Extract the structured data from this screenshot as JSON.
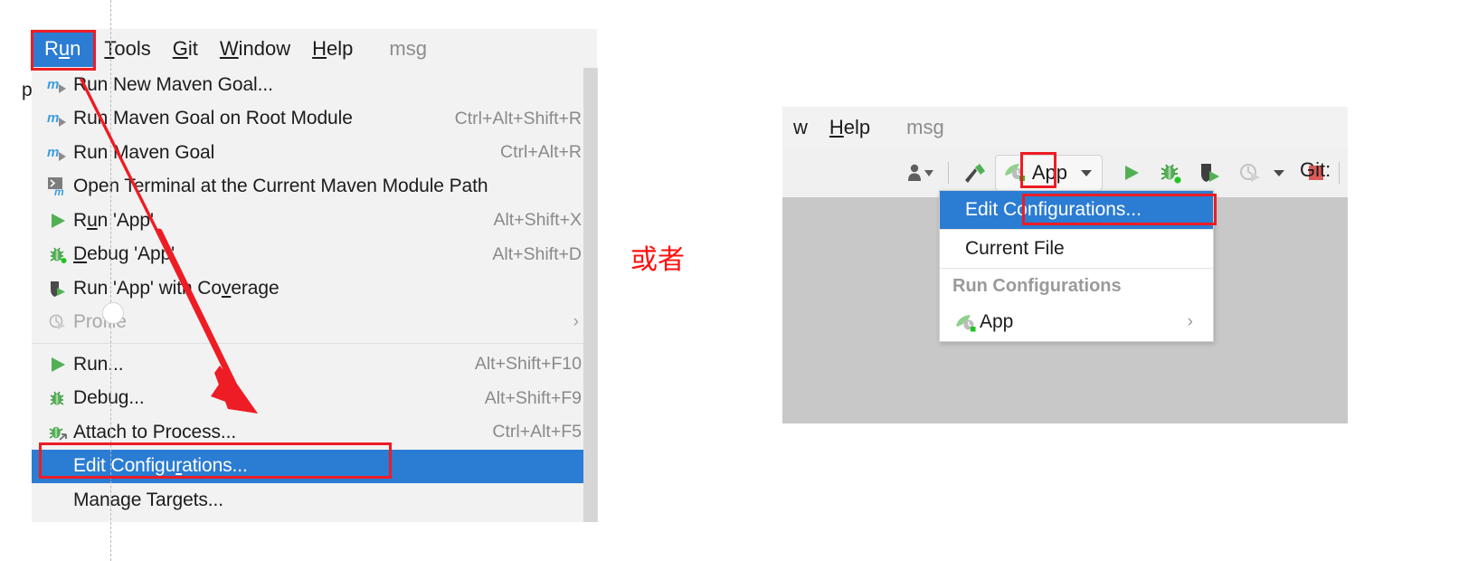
{
  "left_window": {
    "menubar": {
      "items": [
        {
          "label": "Run",
          "accel": "u",
          "selected": true
        },
        {
          "label": "Tools",
          "accel": "T",
          "selected": false
        },
        {
          "label": "Git",
          "accel": "G",
          "selected": false
        },
        {
          "label": "Window",
          "accel": "W",
          "selected": false
        },
        {
          "label": "Help",
          "accel": "H",
          "selected": false
        }
      ],
      "extra_label": "msg"
    },
    "menu_items": [
      {
        "label": "Run New Maven Goal...",
        "shortcut": "",
        "icon": "maven-run-icon",
        "state": "normal"
      },
      {
        "label": "Run Maven Goal on Root Module",
        "shortcut": "Ctrl+Alt+Shift+R",
        "icon": "maven-run-icon",
        "state": "normal"
      },
      {
        "label": "Run Maven Goal",
        "shortcut": "Ctrl+Alt+R",
        "icon": "maven-run-icon",
        "state": "normal"
      },
      {
        "label": "Open Terminal at the Current Maven Module Path",
        "shortcut": "",
        "icon": "maven-terminal-icon",
        "state": "normal"
      },
      {
        "label": "Run 'App'",
        "shortcut": "Alt+Shift+X",
        "icon": "run-play-icon",
        "state": "normal"
      },
      {
        "label": "Debug 'App'",
        "shortcut": "Alt+Shift+D",
        "icon": "debug-bug-icon",
        "state": "normal"
      },
      {
        "label": "Run 'App' with Coverage",
        "shortcut": "",
        "icon": "coverage-shield-icon",
        "state": "normal"
      },
      {
        "label": "Profile",
        "shortcut": "",
        "icon": "profile-icon",
        "state": "disabled",
        "submenu": true
      },
      {
        "separator": true
      },
      {
        "label": "Run...",
        "shortcut": "Alt+Shift+F10",
        "icon": "run-play-icon",
        "state": "normal"
      },
      {
        "label": "Debug...",
        "shortcut": "Alt+Shift+F9",
        "icon": "debug-bug-icon",
        "state": "normal"
      },
      {
        "label": "Attach to Process...",
        "shortcut": "Ctrl+Alt+F5",
        "icon": "attach-process-icon",
        "state": "normal"
      },
      {
        "label": "Edit Configurations...",
        "shortcut": "",
        "icon": "none",
        "state": "selected"
      },
      {
        "label": "Manage Targets...",
        "shortcut": "",
        "icon": "none",
        "state": "normal"
      }
    ],
    "edge_glyph": "p"
  },
  "annotation": {
    "or_text": "或者",
    "color": "#ff1010"
  },
  "right_window": {
    "menubar": {
      "partial_item": "w",
      "items": [
        {
          "label": "Help",
          "accel": "H"
        }
      ],
      "extra_label": "msg"
    },
    "toolbar": {
      "buttons": [
        {
          "name": "user-account-icon",
          "has_dropdown": true
        },
        {
          "name": "build-hammer-icon",
          "has_dropdown": false
        },
        {
          "name": "run-play-icon",
          "has_dropdown": false
        },
        {
          "name": "debug-bug-icon",
          "has_dropdown": false
        },
        {
          "name": "coverage-shield-icon",
          "has_dropdown": false
        },
        {
          "name": "profile-icon",
          "has_dropdown": true
        },
        {
          "name": "stop-square-icon",
          "has_dropdown": false
        }
      ],
      "run_config_label": "App",
      "git_label": "Git:"
    },
    "dropdown": {
      "rows": [
        {
          "label": "Edit Configurations...",
          "state": "selected",
          "icon": "none"
        },
        {
          "separator": true
        },
        {
          "label": "Current File",
          "state": "normal",
          "icon": "none"
        },
        {
          "separator": true
        },
        {
          "label": "Run Configurations",
          "state": "header",
          "icon": "none"
        },
        {
          "label": "App",
          "state": "normal",
          "icon": "spring-boot-icon",
          "submenu": true
        }
      ]
    }
  },
  "colors": {
    "selection_blue": "#2b7cd3",
    "annotation_red": "#ee1c24",
    "menu_bg": "#f2f2f2",
    "editor_grey": "#c8c8c8",
    "green_run": "#52b054",
    "stop_red": "#dc5a5a",
    "maven_blue": "#3b9ede"
  }
}
